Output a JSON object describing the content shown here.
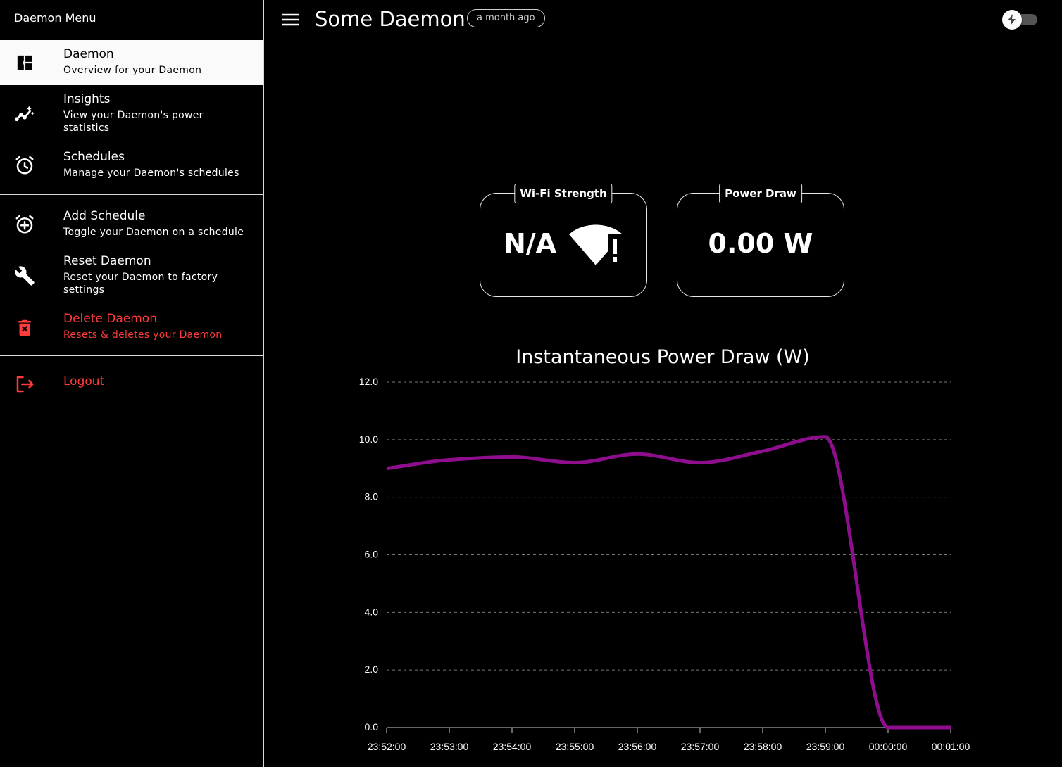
{
  "sidebar": {
    "header": "Daemon Menu",
    "items": [
      {
        "title": "Daemon",
        "subtitle": "Overview for your Daemon",
        "icon": "dashboard-icon"
      },
      {
        "title": "Insights",
        "subtitle_line1": "View your Daemon's power",
        "subtitle_line2": "statistics",
        "icon": "insights-icon"
      },
      {
        "title": "Schedules",
        "subtitle": "Manage your Daemon's schedules",
        "icon": "alarm-icon"
      },
      {
        "title": "Add Schedule",
        "subtitle": "Toggle your Daemon on a schedule",
        "icon": "alarm-add-icon"
      },
      {
        "title": "Reset Daemon",
        "subtitle_line1": "Reset your Daemon to factory",
        "subtitle_line2": "settings",
        "icon": "wrench-icon"
      },
      {
        "title": "Delete Daemon",
        "subtitle": "Resets & deletes your Daemon",
        "icon": "trash-icon"
      },
      {
        "title": "Logout",
        "icon": "logout-icon"
      }
    ]
  },
  "header": {
    "title": "Some Daemon",
    "last_seen": "a month ago",
    "power_toggle_on": false
  },
  "cards": {
    "wifi": {
      "label": "Wi-Fi Strength",
      "value": "N/A",
      "icon": "wifi-alert-icon"
    },
    "power": {
      "label": "Power Draw",
      "value": "0.00 W"
    }
  },
  "colors": {
    "accent": "#8e0e8e",
    "danger": "#ff3b3b"
  },
  "chart_data": {
    "type": "line",
    "title": "Instantaneous Power Draw (W)",
    "xlabel": "",
    "ylabel": "",
    "x_ticks": [
      "23:52:00",
      "23:53:00",
      "23:54:00",
      "23:55:00",
      "23:56:00",
      "23:57:00",
      "23:58:00",
      "23:59:00",
      "00:00:00",
      "00:01:00"
    ],
    "y_ticks": [
      "0.0",
      "2.0",
      "4.0",
      "6.0",
      "8.0",
      "10.0",
      "12.0"
    ],
    "ylim": [
      0,
      12
    ],
    "grid": true,
    "series": [
      {
        "x_minutes": [
          0,
          1,
          2,
          3,
          4,
          5,
          6,
          7,
          8,
          9
        ],
        "values": [
          9.0,
          9.3,
          9.4,
          9.2,
          9.5,
          9.2,
          9.6,
          10.1,
          0.0,
          0.0
        ]
      }
    ]
  }
}
